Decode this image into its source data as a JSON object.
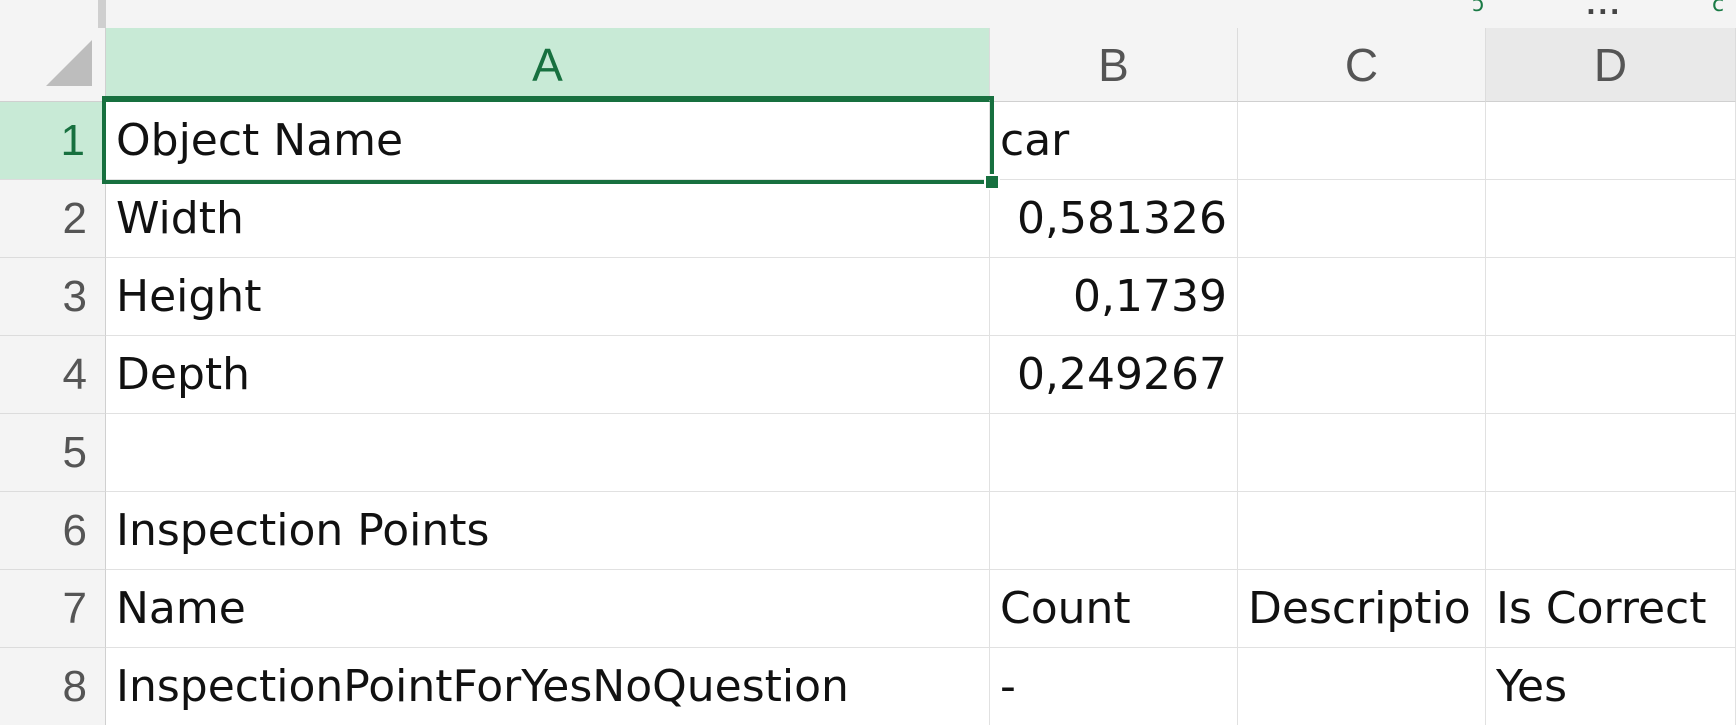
{
  "colors": {
    "accent": "#17703f",
    "selected_header_bg": "#c8ead6",
    "header_bg": "#f4f4f4",
    "gridline": "#e1e1e1"
  },
  "toolbar": {
    "icons": [
      "green-action-icon",
      "more-options-icon",
      "green-action-icon-2"
    ],
    "more_label": "..."
  },
  "columns": [
    "A",
    "B",
    "C",
    "D"
  ],
  "rows": [
    "1",
    "2",
    "3",
    "4",
    "5",
    "6",
    "7",
    "8"
  ],
  "active_cell": "A1",
  "cells": {
    "r1": {
      "a": "Object Name",
      "b": "car",
      "c": "",
      "d": ""
    },
    "r2": {
      "a": "Width",
      "b": "0,581326",
      "c": "",
      "d": ""
    },
    "r3": {
      "a": "Height",
      "b": "0,1739",
      "c": "",
      "d": ""
    },
    "r4": {
      "a": "Depth",
      "b": "0,249267",
      "c": "",
      "d": ""
    },
    "r5": {
      "a": "",
      "b": "",
      "c": "",
      "d": ""
    },
    "r6": {
      "a": "Inspection Points",
      "b": "",
      "c": "",
      "d": ""
    },
    "r7": {
      "a": "Name",
      "b": "Count",
      "c": "Descriptio",
      "d": "Is Correct"
    },
    "r8": {
      "a": "InspectionPointForYesNoQuestion",
      "b": "-",
      "c": "",
      "d": "Yes"
    }
  }
}
